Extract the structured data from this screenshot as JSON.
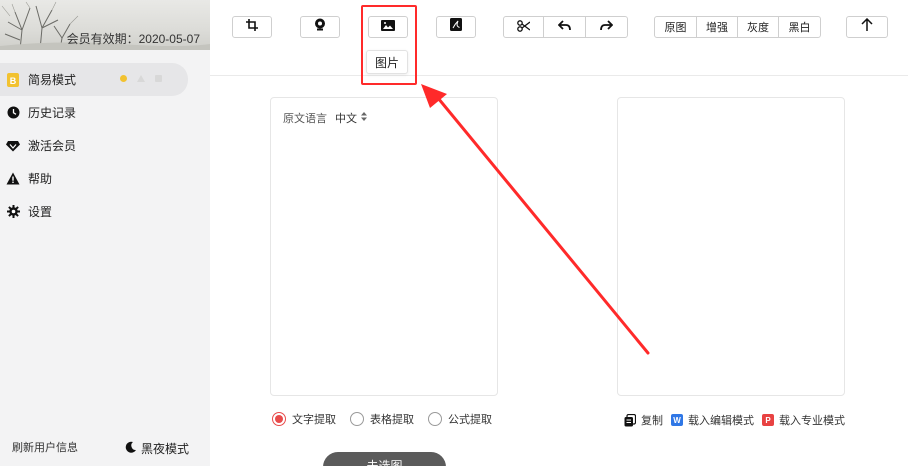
{
  "sidebar": {
    "membership_label": "会员有效期：2020-05-07",
    "items": [
      {
        "label": "简易模式",
        "icon": "b-square-icon"
      },
      {
        "label": "历史记录",
        "icon": "clock-icon"
      },
      {
        "label": "激活会员",
        "icon": "diamond-icon"
      },
      {
        "label": "帮助",
        "icon": "warning-icon"
      },
      {
        "label": "设置",
        "icon": "gear-icon"
      }
    ],
    "refresh_label": "刷新用户信息",
    "night_mode_label": "黑夜模式"
  },
  "toolbar": {
    "image_tooltip": "图片",
    "view_modes": [
      "原图",
      "增强",
      "灰度",
      "黑白"
    ]
  },
  "source_panel": {
    "language_label": "原文语言",
    "language_value": "中文"
  },
  "extract_options": [
    {
      "label": "文字提取",
      "selected": true
    },
    {
      "label": "表格提取",
      "selected": false
    },
    {
      "label": "公式提取",
      "selected": false
    }
  ],
  "result_actions": {
    "copy_label": "复制",
    "load_edit_label": "载入编辑模式",
    "load_pro_label": "载入专业模式",
    "word_badge": "W",
    "ppt_badge": "P"
  },
  "select_button_label": "未选图",
  "colors": {
    "accent_red": "#e84b4b",
    "highlight_red": "#ff2a2a",
    "active_dot": "#f2c230",
    "word_blue": "#2f77e6"
  }
}
